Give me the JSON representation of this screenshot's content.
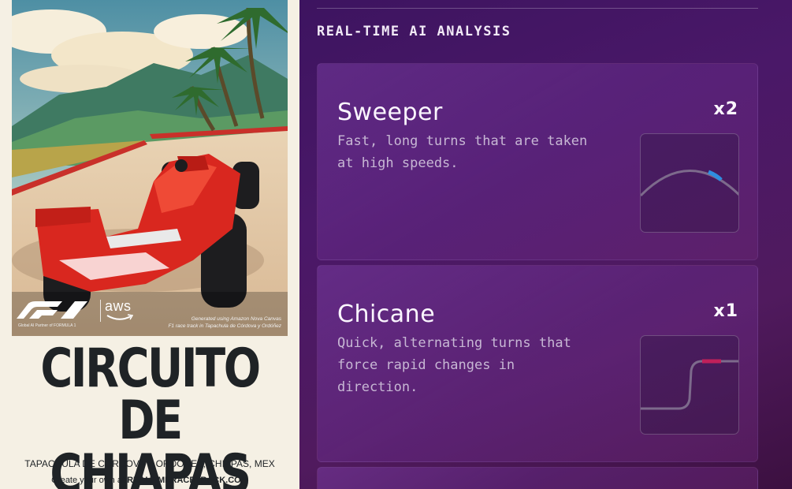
{
  "poster": {
    "title_line1": "CIRCUITO",
    "title_line2": "DE CHIAPAS",
    "location": "TAPACHULA DE CÓRDOVA Y ORDÓÑEZ, CHIAPAS, MEX",
    "cta_prefix": "Create your own at ",
    "cta_site": "REALTIMERACETRACK.COM",
    "aws_logo_text": "aws",
    "partner_text": "Global AI Partner of FORMULA 1",
    "generated_line1": "Generated using Amazon Nova Canvas",
    "generated_line2": "F1 race track in Tapachula de Córdova y Ordóñez"
  },
  "panel": {
    "heading": "REAL-TIME AI ANALYSIS",
    "cards": [
      {
        "title": "Sweeper",
        "count": "x2",
        "description": "Fast, long turns that are taken at high speeds.",
        "highlight_color": "#2f8ee0"
      },
      {
        "title": "Chicane",
        "count": "x1",
        "description": "Quick, alternating turns that force rapid changes in direction.",
        "highlight_color": "#c0205a"
      }
    ]
  },
  "colors": {
    "poster_bg": "#f5f0e4",
    "title_ink": "#1f2326",
    "panel_bg": "#4a1868",
    "card_text": "#fbf6ff",
    "card_desc": "#c7b7d4"
  }
}
